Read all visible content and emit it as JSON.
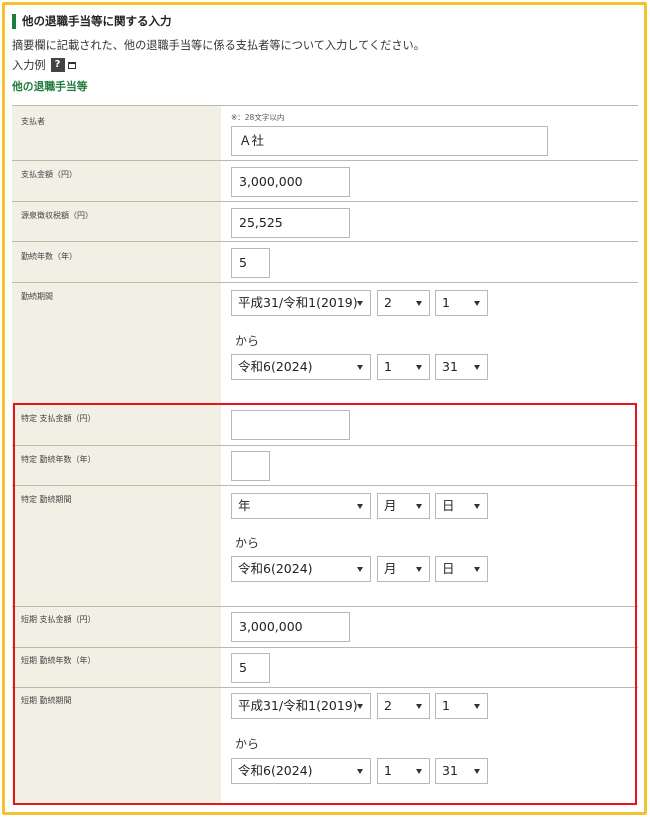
{
  "section": {
    "title": "他の退職手当等に関する入力",
    "description": "摘要欄に記載された、他の退職手当等に係る支払者等について入力してください。",
    "example_label": "入力例",
    "help_icon_text": "?",
    "subsection_title": "他の退職手当等"
  },
  "fields": {
    "payer": {
      "label": "支払者",
      "hint": "※：28文字以内",
      "value": "Ａ社"
    },
    "payment_amount": {
      "label": "支払金額（円）",
      "value": "3,000,000"
    },
    "withholding_tax": {
      "label": "源泉徴収税額（円）",
      "value": "25,525"
    },
    "service_years": {
      "label": "勤続年数（年）",
      "value": "5"
    },
    "service_period": {
      "label": "勤続期間",
      "start": {
        "era": "平成31/令和1(2019)",
        "month": "2",
        "day": "1"
      },
      "from_text": "から",
      "end": {
        "era": "令和6(2024)",
        "month": "1",
        "day": "31"
      }
    },
    "specific_payment_amount": {
      "label": "特定 支払金額（円）",
      "value": ""
    },
    "specific_service_years": {
      "label": "特定 勤続年数（年）",
      "value": ""
    },
    "specific_service_period": {
      "label": "特定 勤続期間",
      "start": {
        "era": "年",
        "month": "月",
        "day": "日"
      },
      "from_text": "から",
      "end": {
        "era": "令和6(2024)",
        "month": "月",
        "day": "日"
      }
    },
    "short_payment_amount": {
      "label": "短期 支払金額（円）",
      "value": "3,000,000"
    },
    "short_service_years": {
      "label": "短期 勤続年数（年）",
      "value": "5"
    },
    "short_service_period": {
      "label": "短期 勤続期間",
      "start": {
        "era": "平成31/令和1(2019)",
        "month": "2",
        "day": "1"
      },
      "from_text": "から",
      "end": {
        "era": "令和6(2024)",
        "month": "1",
        "day": "31"
      }
    }
  },
  "colors": {
    "accent_green": "#1f7a3d",
    "highlight_yellow": "#f5c12e",
    "highlight_red": "#e8141b",
    "label_background": "#f2efe5"
  }
}
